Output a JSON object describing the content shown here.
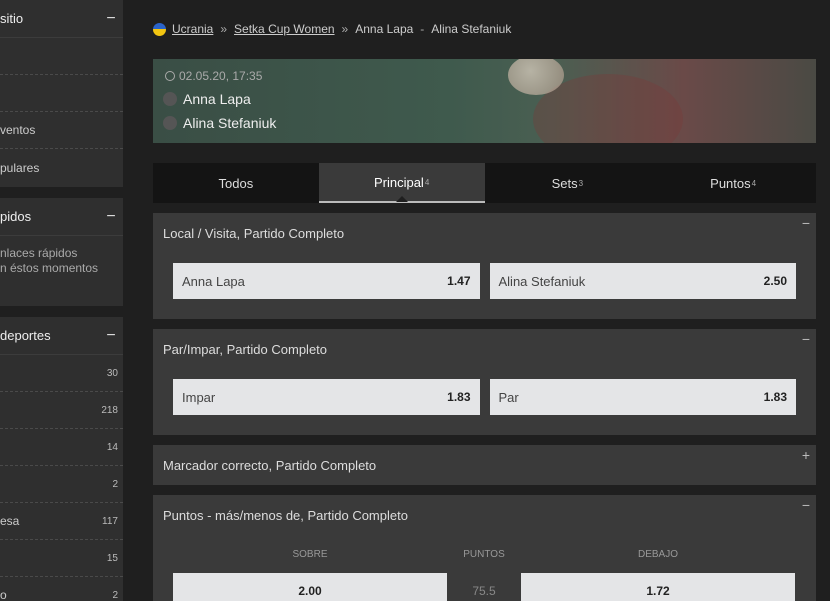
{
  "sidebar": {
    "site": {
      "title": "sitio",
      "items": [
        {
          "label": ""
        },
        {
          "label": ""
        },
        {
          "label": "ventos"
        },
        {
          "label": "pulares"
        }
      ]
    },
    "quick": {
      "title": "pidos",
      "text1": "nlaces rápidos",
      "text2": "n éstos momentos"
    },
    "sports": {
      "title": "deportes",
      "items": [
        {
          "label": "",
          "count": "30"
        },
        {
          "label": "",
          "count": "218"
        },
        {
          "label": "",
          "count": "14"
        },
        {
          "label": "",
          "count": "2"
        },
        {
          "label": "esa",
          "count": "117"
        },
        {
          "label": "",
          "count": "15"
        },
        {
          "label": "o",
          "count": "2"
        }
      ]
    }
  },
  "breadcrumb": {
    "country": "Ucrania",
    "league": "Setka Cup Women",
    "match_home": "Anna Lapa",
    "match_sep": "-",
    "match_away": "Alina Stefaniuk",
    "sep": "»"
  },
  "event": {
    "datetime": "02.05.20, 17:35",
    "home": "Anna Lapa",
    "away": "Alina Stefaniuk"
  },
  "tabs": [
    {
      "label": "Todos",
      "count": ""
    },
    {
      "label": "Principal",
      "count": "4"
    },
    {
      "label": "Sets",
      "count": "3"
    },
    {
      "label": "Puntos",
      "count": "4"
    }
  ],
  "markets": {
    "m1": {
      "title": "Local / Visita, Partido Completo",
      "toggle": "−",
      "o1_label": "Anna Lapa",
      "o1_odd": "1.47",
      "o2_label": "Alina Stefaniuk",
      "o2_odd": "2.50"
    },
    "m2": {
      "title": "Par/Impar, Partido Completo",
      "toggle": "−",
      "o1_label": "Impar",
      "o1_odd": "1.83",
      "o2_label": "Par",
      "o2_odd": "1.83"
    },
    "m3": {
      "title": "Marcador correcto, Partido Completo",
      "toggle": "+"
    },
    "m4": {
      "title": "Puntos - más/menos de, Partido Completo",
      "toggle": "−",
      "h_over": "SOBRE",
      "h_points": "PUNTOS",
      "h_under": "DEBAJO",
      "over_odd": "2.00",
      "points": "75.5",
      "under_odd": "1.72"
    }
  }
}
